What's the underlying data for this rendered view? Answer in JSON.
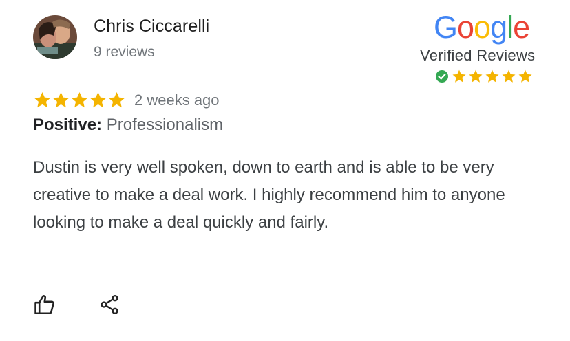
{
  "reviewer": {
    "name": "Chris Ciccarelli",
    "review_count": "9 reviews"
  },
  "badge": {
    "logo": "Google",
    "subtitle": "Verified Reviews",
    "stars": 5,
    "colors": {
      "blue": "#4285F4",
      "red": "#EA4335",
      "yellow": "#FBBC05",
      "green": "#34A853",
      "star": "#F4B400"
    }
  },
  "review": {
    "rating": 5,
    "age": "2 weeks ago",
    "positive_label": "Positive:",
    "positive_value": "Professionalism",
    "text": "Dustin is very well spoken, down to earth and is able to be very creative to make a deal work. I highly recommend him to anyone looking to make a deal quickly and fairly."
  },
  "actions": {
    "like_icon": "thumbs-up-icon",
    "share_icon": "share-icon"
  }
}
